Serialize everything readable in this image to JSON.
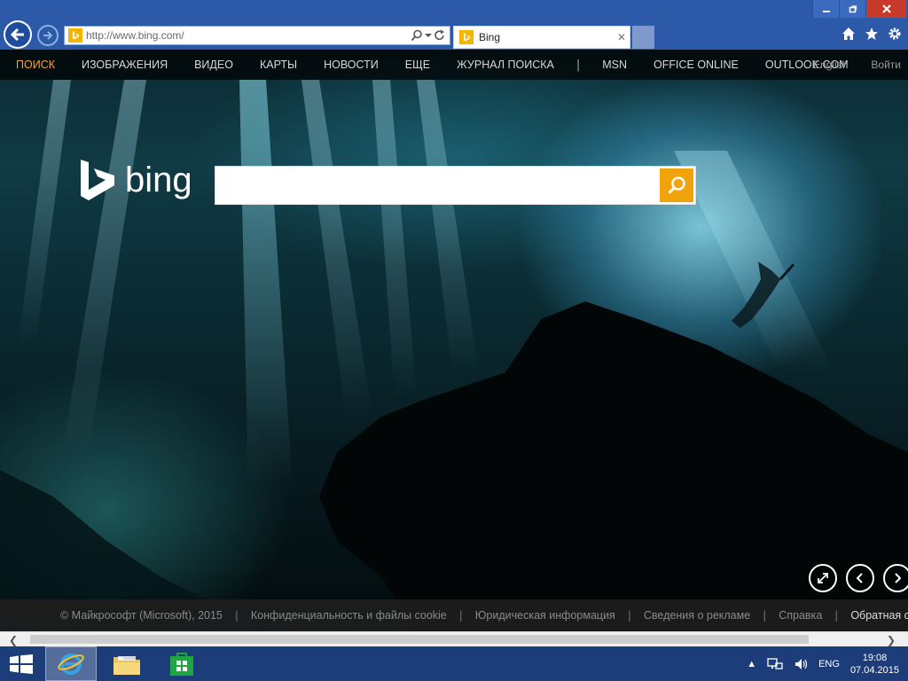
{
  "browser": {
    "url": "http://www.bing.com/",
    "tab_title": "Bing",
    "window_buttons": [
      "minimize",
      "restore",
      "close"
    ]
  },
  "topnav": {
    "items": [
      "ПОИСК",
      "ИЗОБРАЖЕНИЯ",
      "ВИДЕО",
      "КАРТЫ",
      "НОВОСТИ",
      "ЕЩЕ",
      "ЖУРНАЛ ПОИСКА"
    ],
    "separator": "|",
    "links": [
      "MSN",
      "OFFICE ONLINE",
      "OUTLOOK.COM"
    ],
    "language": "English",
    "signin": "Войти"
  },
  "logo": {
    "text": "bing"
  },
  "search": {
    "value": ""
  },
  "footer": {
    "copyright": "© Майкрософт (Microsoft), 2015",
    "links": [
      "Конфиденциальность и файлы cookie",
      "Юридическая информация",
      "Сведения о рекламе",
      "Справка",
      "Обратная связь"
    ],
    "separator": "|"
  },
  "taskbar": {
    "language": "ENG",
    "time": "19:08",
    "date": "07.04.2015"
  },
  "colors": {
    "accent": "#f0a30a",
    "nav_active": "#f3a53a",
    "taskbar": "#1c3d7a",
    "titlebar": "#2c5aa9"
  }
}
